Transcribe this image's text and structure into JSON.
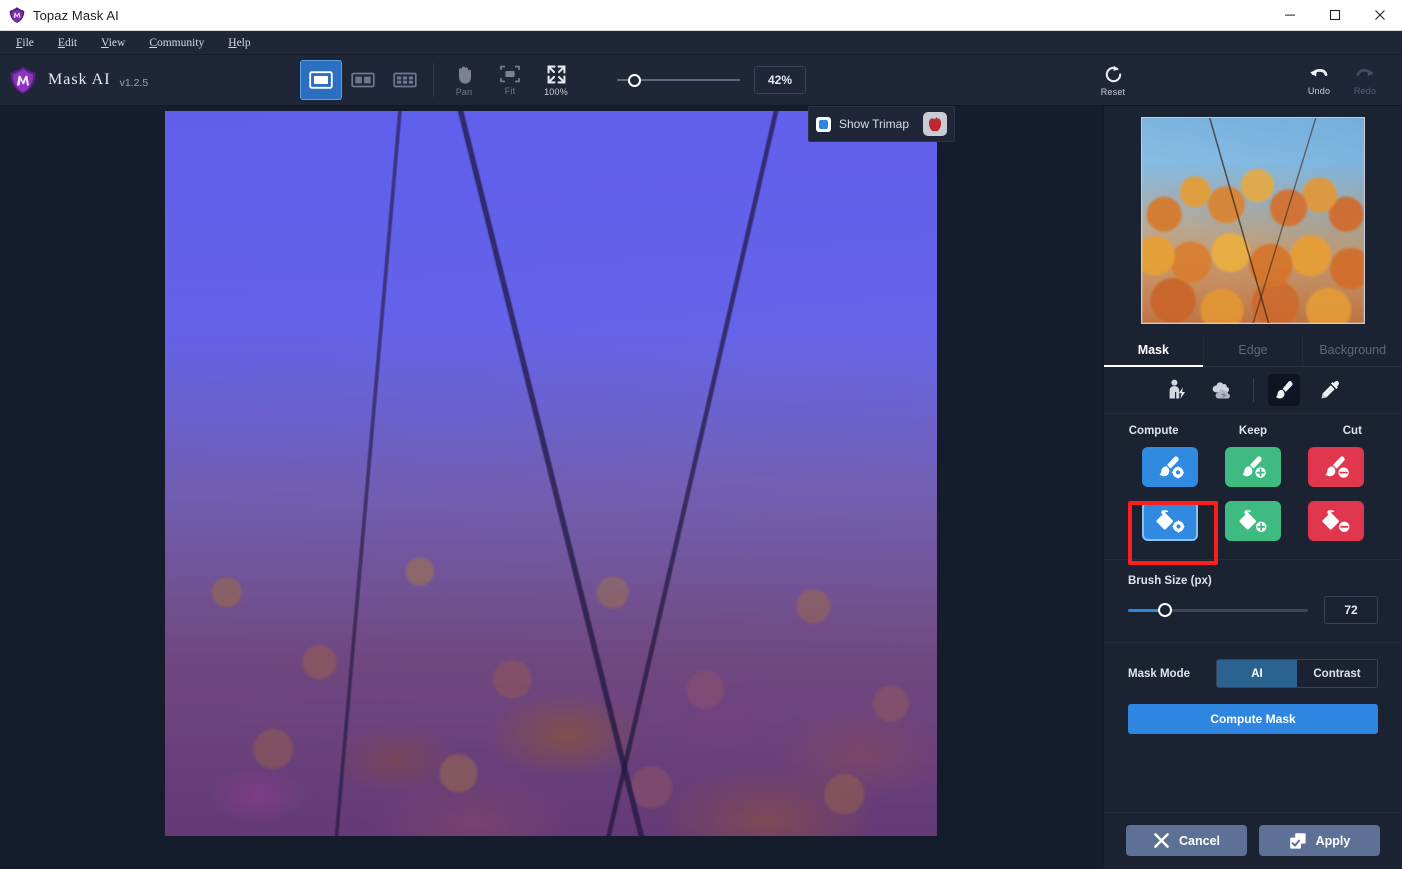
{
  "window": {
    "title": "Topaz Mask AI",
    "logo_icon": "topaz-shield-icon",
    "minimize_label": "—",
    "maximize_label": "☐",
    "close_label": "✕"
  },
  "menubar": {
    "items": [
      {
        "label": "File",
        "accel": "F"
      },
      {
        "label": "Edit",
        "accel": "E"
      },
      {
        "label": "View",
        "accel": "V"
      },
      {
        "label": "Community",
        "accel": "C"
      },
      {
        "label": "Help",
        "accel": "H"
      }
    ]
  },
  "brand": {
    "name": "Mask AI",
    "version": "v1.2.5",
    "logo_icon": "mask-ai-shield-logo"
  },
  "toolbar": {
    "view_modes": [
      {
        "name": "single-view",
        "icon": "single-pane-icon",
        "active": true
      },
      {
        "name": "split-view",
        "icon": "two-pane-icon",
        "active": false
      },
      {
        "name": "multi-view",
        "icon": "four-pane-icon",
        "active": false
      }
    ],
    "nav_buttons": [
      {
        "label": "Pan",
        "icon": "hand-icon",
        "enabled": false
      },
      {
        "label": "Fit",
        "icon": "fit-frame-icon",
        "enabled": false
      },
      {
        "label": "100%",
        "icon": "expand-arrows-icon",
        "enabled": true
      }
    ],
    "zoom": {
      "value": "42%",
      "slider_percent": 9
    },
    "reset": {
      "label": "Reset",
      "icon": "reset-circular-arrow-icon"
    },
    "undo": {
      "label": "Undo",
      "icon": "undo-arrow-icon",
      "enabled": true
    },
    "redo": {
      "label": "Redo",
      "icon": "redo-arrow-icon",
      "enabled": false
    }
  },
  "canvas": {
    "trimap_bar": {
      "checkbox_label": "Show Trimap",
      "checked": true,
      "checkbox_color": "#2f86e0",
      "preset_icon": "apple-thumbnail-icon"
    },
    "image_description": "Autumn tree foliage against sky with blue-purple trimap overlay"
  },
  "panel": {
    "preview": {
      "name": "image-thumbnail",
      "description": "Autumn tree with orange leaves against blue sky"
    },
    "tabs": [
      {
        "label": "Mask",
        "active": true
      },
      {
        "label": "Edge",
        "active": false
      },
      {
        "label": "Background",
        "active": false
      }
    ],
    "tools": [
      {
        "name": "ai-subject-tool",
        "icon": "person-lightning-icon",
        "selected": false
      },
      {
        "name": "sky-tool",
        "icon": "clouds-icon",
        "selected": false
      },
      {
        "name": "brush-tool",
        "icon": "brush-icon",
        "selected": true
      },
      {
        "name": "eyedropper-tool",
        "icon": "eyedropper-icon",
        "selected": false
      }
    ],
    "column_labels": [
      "Compute",
      "Keep",
      "Cut"
    ],
    "tool_grid": [
      {
        "name": "brush-compute",
        "icon": "brush-gear-icon",
        "color": "#2f8ae0",
        "tone": "blue",
        "selected": false
      },
      {
        "name": "brush-keep",
        "icon": "brush-plus-icon",
        "color": "#3fbb82",
        "tone": "green",
        "selected": false
      },
      {
        "name": "brush-cut",
        "icon": "brush-minus-icon",
        "color": "#e0374f",
        "tone": "red",
        "selected": false
      },
      {
        "name": "fill-compute",
        "icon": "fill-bucket-gear-icon",
        "color": "#2f8ae0",
        "tone": "blue",
        "selected": true
      },
      {
        "name": "fill-keep",
        "icon": "fill-bucket-plus-icon",
        "color": "#3fbb82",
        "tone": "green",
        "selected": false
      },
      {
        "name": "fill-cut",
        "icon": "fill-bucket-minus-icon",
        "color": "#e0374f",
        "tone": "red",
        "selected": false
      }
    ],
    "highlight_color": "#ff1e1e",
    "brush_size": {
      "label": "Brush Size (px)",
      "value": "72",
      "slider_percent": 18
    },
    "mask_mode": {
      "label": "Mask Mode",
      "options": [
        "AI",
        "Contrast"
      ],
      "selected": "AI"
    },
    "compute_mask_button": {
      "label": "Compute Mask",
      "color": "#2f86e0"
    },
    "footer": {
      "cancel": {
        "label": "Cancel",
        "icon": "close-x-icon"
      },
      "apply": {
        "label": "Apply",
        "icon": "apply-check-icon"
      }
    }
  }
}
